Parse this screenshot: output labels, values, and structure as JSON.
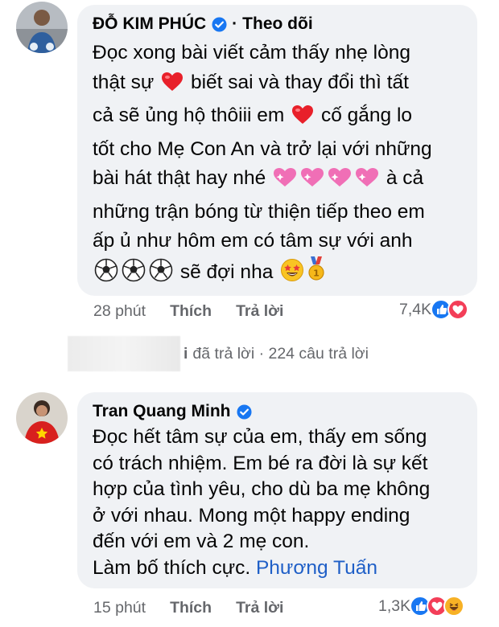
{
  "comment1": {
    "author": "ĐỖ KIM PHÚC",
    "separator": "·",
    "follow_label": "Theo dõi",
    "lines": [
      "Đọc xong bài viết cảm thấy nhẹ lòng",
      "thật sự",
      "biết sai và thay đổi thì tất",
      "cả sẽ ủng hộ thôiii em",
      "cố gắng lo",
      "tốt cho Mẹ Con An và trở lại với những",
      "bài hát thật hay nhé",
      "à cả",
      "những trận bóng từ thiện tiếp theo em",
      "ấp ủ như hôm em có tâm sự với anh",
      "sẽ đợi nha"
    ],
    "time": "28 phút",
    "like_label": "Thích",
    "reply_label": "Trả lời",
    "reaction_count": "7,4K"
  },
  "replies": {
    "who": "i",
    "text": "đã trả lời · 224 câu trả lời"
  },
  "comment2": {
    "author": "Tran Quang Minh",
    "lines": [
      "Đọc hết tâm sự của em, thấy em sống",
      "có trách nhiệm. Em bé ra đời là sự kết",
      "hợp của tình yêu, cho dù ba mẹ không",
      "ở với nhau. Mong một happy ending",
      "đến với em và 2 mẹ con.",
      "Làm bố thích cực."
    ],
    "mention": "Phương Tuấn",
    "time": "15 phút",
    "like_label": "Thích",
    "reply_label": "Trả lời",
    "reaction_count": "1,3K"
  },
  "colors": {
    "bubble": "#f0f2f5",
    "meta": "#65676b",
    "link": "#1f5fc7",
    "verified": "#1877f2",
    "like": "#1877f2",
    "love": "#f33e58",
    "haha": "#f7b125"
  },
  "icons": [
    "verified-badge-icon",
    "red-heart-emoji",
    "pink-heart-emoji",
    "soccer-ball-emoji",
    "star-struck-emoji",
    "medal-emoji",
    "like-reaction-icon",
    "love-reaction-icon",
    "haha-reaction-icon"
  ]
}
